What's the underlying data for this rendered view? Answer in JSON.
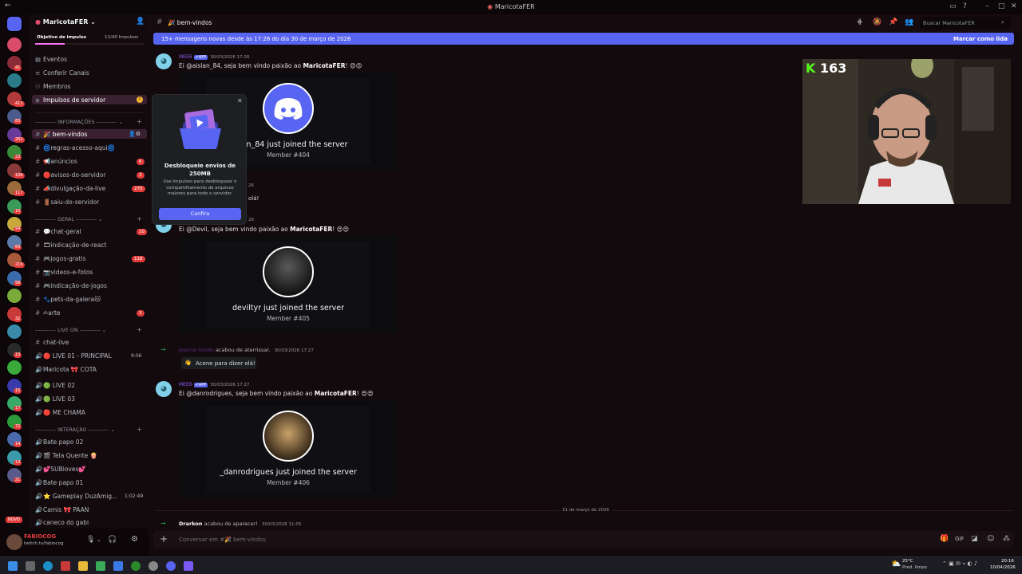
{
  "window": {
    "title": "MaricotaFER"
  },
  "server": {
    "name": "MaricotaFER",
    "boost_goal": "Objetivo de impulso",
    "boost_count": "11/40 Impulsos"
  },
  "nav": [
    {
      "label": "Eventos"
    },
    {
      "label": "Conferir Canais"
    },
    {
      "label": "Membros"
    },
    {
      "label": "Impulsos de servidor"
    }
  ],
  "categories": {
    "info": "INFORMAÇÕES",
    "geral": "GERAL",
    "live": "LIVE ON",
    "interacao": "INTERAÇÃO"
  },
  "channels_info": [
    {
      "name": "🎉 bem-vindos",
      "count": ""
    },
    {
      "name": "🌀regras-acesso-aqui🌀",
      "count": ""
    },
    {
      "name": "📢anúncios",
      "count": "6"
    },
    {
      "name": "🔴avisos-do-servidor",
      "count": "2"
    },
    {
      "name": "📣divulgação-da-live",
      "count": "270"
    },
    {
      "name": "🚪saiu-do-servidor",
      "count": ""
    }
  ],
  "channels_geral": [
    {
      "name": "💬chat-geral",
      "count": "10"
    },
    {
      "name": "🎞indicação-de-react",
      "count": ""
    },
    {
      "name": "🎮jogos-gratis",
      "count": "118"
    },
    {
      "name": "📷videos-e-fotos",
      "count": ""
    },
    {
      "name": "🎮indicação-de-jogos",
      "count": ""
    },
    {
      "name": "🐾pets-da-galera🐱",
      "count": ""
    },
    {
      "name": "✍arte",
      "count": "3"
    }
  ],
  "channels_live": [
    {
      "name": "chat-live",
      "time": ""
    },
    {
      "name": "🔴 LIVE 01 - PRINCIPAL",
      "time": "9:06"
    },
    {
      "name": "Maricota 🎀 COTA",
      "time": ""
    },
    {
      "name": "🟢 LIVE 02",
      "time": ""
    },
    {
      "name": "🟢 LIVE 03",
      "time": ""
    },
    {
      "name": "🔴 ME CHAMA",
      "time": ""
    }
  ],
  "channels_interacao": [
    {
      "name": "Bate papo 02",
      "time": ""
    },
    {
      "name": "🎬 Tela Quente 🍿",
      "time": ""
    },
    {
      "name": "💕SUBloves💕",
      "time": ""
    },
    {
      "name": "Bate papo 01",
      "time": ""
    },
    {
      "name": "⭐ Gameplay DuzAmig...",
      "time": "1:02:49"
    },
    {
      "name": "Camis 🎀 PAAN",
      "time": ""
    },
    {
      "name": "caneco do gabi",
      "time": ""
    }
  ],
  "user": {
    "name": "FABIOCOG",
    "status": "twitch.tv/fabiocog",
    "novo": "NOVO"
  },
  "header": {
    "channel": "🎉 bem-vindos",
    "search": "Buscar MaricotaFER"
  },
  "banner": {
    "text": "15+ mensagens novas desde às 17:26 do dia 30 de março de 2026",
    "action": "Marcar como lida"
  },
  "messages": [
    {
      "author": "MEE6",
      "tag": "✔APP",
      "time": "30/03/2026 17:26",
      "pre": "Ei @aislan_84, seja bem vindo paixão ao ",
      "bold": "MaricotaFER",
      "post": "! 😍😍",
      "join": "aislan_84 just joined the server",
      "member": "Member #404",
      "avatar": "discord"
    },
    {
      "author": "MEE6",
      "tag": "✔APP",
      "time": "30/03/2026 17:26",
      "pre": "Ei @Devil, seja bem vindo paixão ao ",
      "bold": "MaricotaFER",
      "post": "! 😍😍",
      "join": "deviltyr just joined the server",
      "member": "Member #405",
      "avatar": "dark"
    },
    {
      "author": "MEE6",
      "tag": "✔APP",
      "time": "30/03/2026 17:27",
      "pre": "Ei @danrodrigues, seja bem vindo paixão ao ",
      "bold": "MaricotaFER",
      "post": "! 😍😍",
      "join": "_danrodrigues just joined the server",
      "member": "Member #406",
      "avatar": "man"
    }
  ],
  "system": {
    "who": "Jeanne Gordo",
    "action": "acabou de aterrissar.",
    "time": "30/03/2026 17:27",
    "wave": "Acene para dizer olá!"
  },
  "partial": {
    "stamp": "26",
    "text": "olá!"
  },
  "divider": "31 de março de 2026",
  "last": {
    "who": "Drarkon",
    "action": "acabou de aparecer!",
    "time": "30/03/2026 11:05"
  },
  "popup": {
    "title": "Desbloqueie envios de 250MB",
    "body": "Use impulsos para desbloquear o compartilhamento de arquivos maiores para todo o servidor.",
    "button": "Confira"
  },
  "input": {
    "placeholder": "Conversar em #🎉 bem-vindos"
  },
  "webcam": {
    "counter": "163"
  },
  "taskbar": {
    "temp": "25°C",
    "weather": "Pred. limpo",
    "time": "20:16",
    "date": "10/04/2026"
  },
  "servers": [
    {
      "color": "#d94b6b",
      "badge": ""
    },
    {
      "color": "#8a2b3a",
      "badge": "41"
    },
    {
      "color": "#2a7a8a",
      "badge": ""
    },
    {
      "color": "#b23a3a",
      "badge": "413"
    },
    {
      "color": "#4a5a8a",
      "badge": "83"
    },
    {
      "color": "#6a3a9a",
      "badge": "261"
    },
    {
      "color": "#3a8a3a",
      "badge": "23"
    },
    {
      "color": "#8a3a3a",
      "badge": "106"
    },
    {
      "color": "#9a6a3a",
      "badge": "117"
    },
    {
      "color": "#3a9a5a",
      "badge": "10"
    },
    {
      "color": "#c8a83a",
      "badge": "94"
    },
    {
      "color": "#5a7aaa",
      "badge": "69"
    },
    {
      "color": "#aa5a3a",
      "badge": "216"
    },
    {
      "color": "#3a6aaa",
      "badge": "99"
    },
    {
      "color": "#7aaa3a",
      "badge": ""
    },
    {
      "color": "#c83a3a",
      "badge": "32"
    },
    {
      "color": "#3a8aaa",
      "badge": ""
    },
    {
      "color": "#2a2a2a",
      "badge": "13"
    },
    {
      "color": "#3aaa3a",
      "badge": ""
    },
    {
      "color": "#3a3aaa",
      "badge": "15"
    },
    {
      "color": "#3aaa6a",
      "badge": "17"
    },
    {
      "color": "#2a9a3a",
      "badge": "72"
    },
    {
      "color": "#4a6aaa",
      "badge": "14"
    },
    {
      "color": "#3a9aaa",
      "badge": "13"
    },
    {
      "color": "#5a5a8a",
      "badge": "21"
    }
  ]
}
